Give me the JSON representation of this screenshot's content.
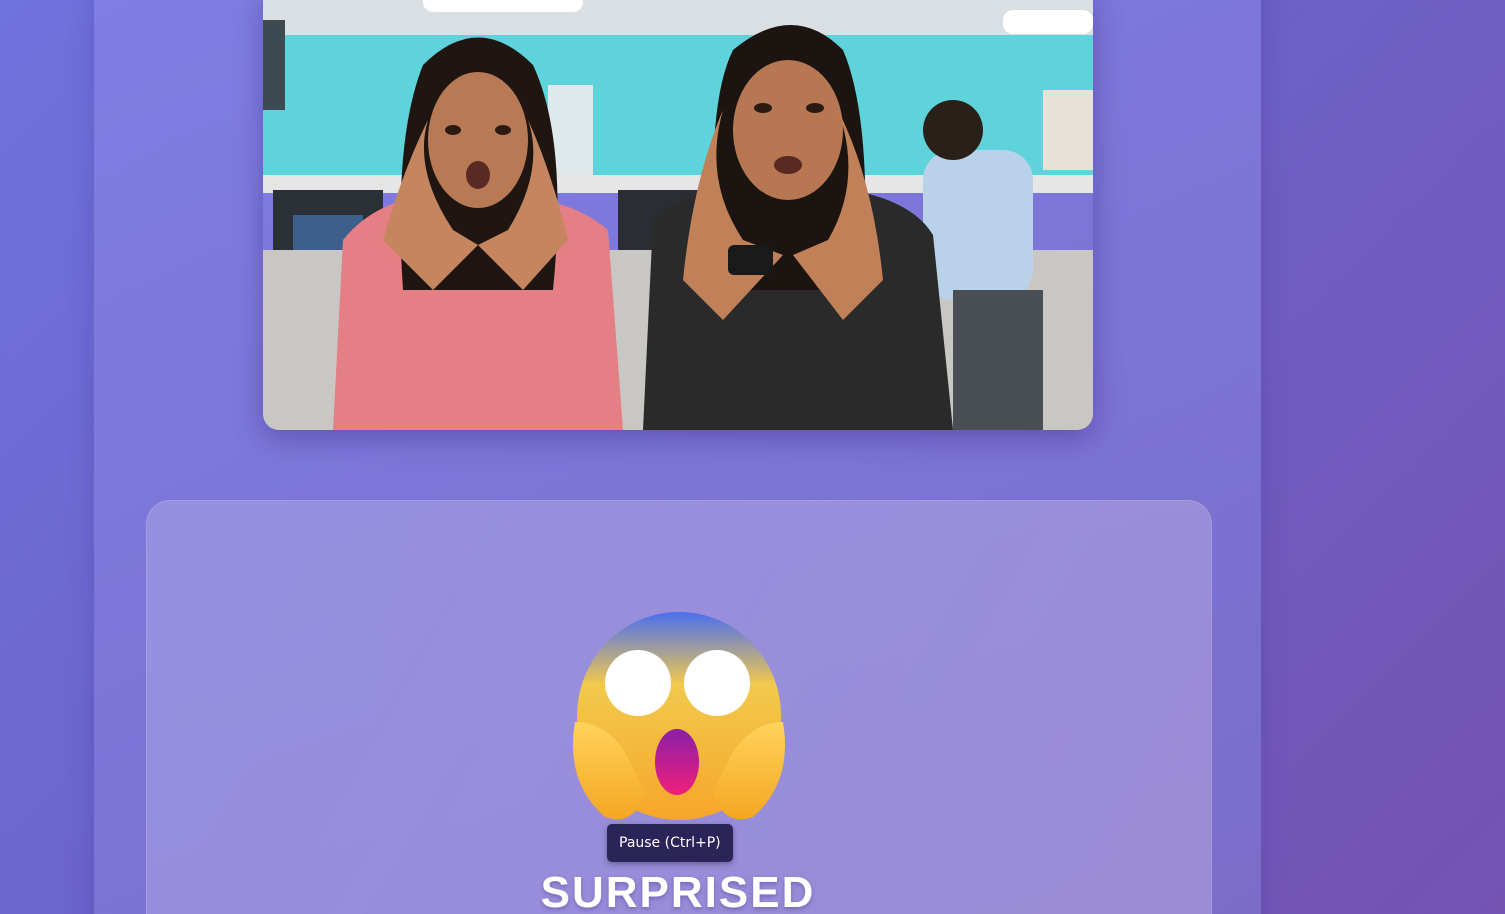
{
  "camera": {
    "icon": "camera-feed-icon"
  },
  "result": {
    "emoji_icon": "face-screaming-in-fear-icon",
    "emotion": "SURPRISED"
  },
  "tooltip": {
    "text": "Pause (Ctrl+P)"
  },
  "colors": {
    "background_start": "#6f73dd",
    "background_end": "#7453b3",
    "tooltip_bg": "#2b2458",
    "label_text": "#ffffff"
  }
}
